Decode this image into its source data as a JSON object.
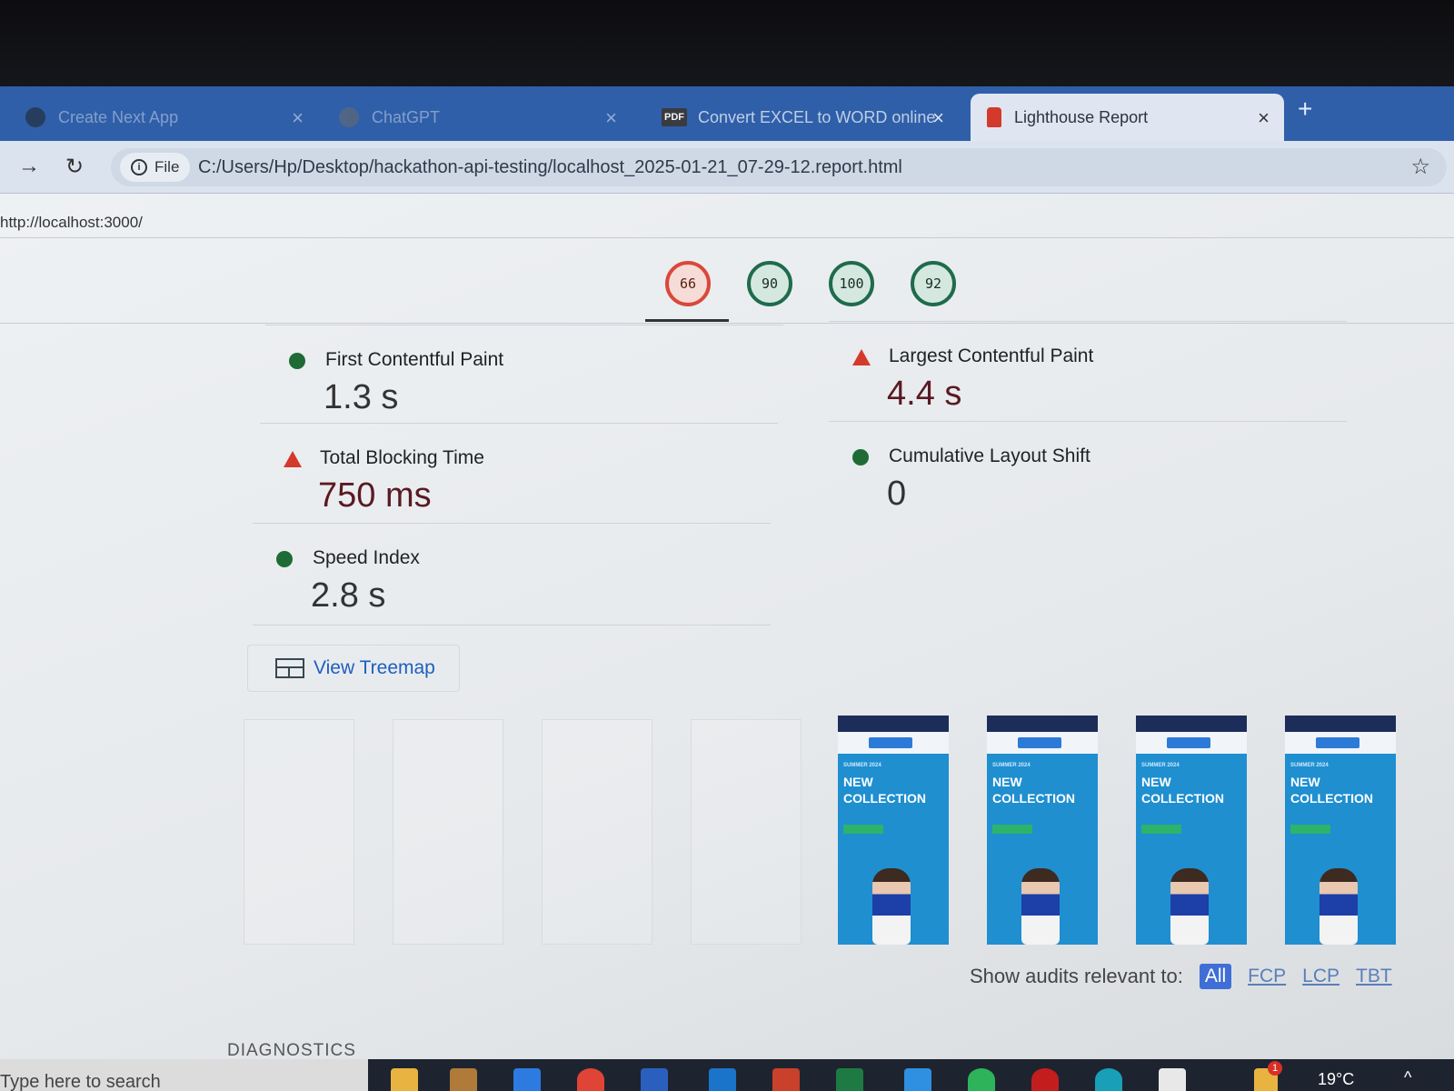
{
  "browser": {
    "tabs": [
      {
        "title": "Create Next App",
        "close": "×",
        "state": "inactive",
        "icon": "next-app-icon"
      },
      {
        "title": "ChatGPT",
        "close": "×",
        "state": "inactive",
        "icon": "chatgpt-icon"
      },
      {
        "title": "Convert EXCEL to WORD online",
        "close": "×",
        "state": "inactive",
        "icon": "pdf-icon",
        "badge": "PDF"
      },
      {
        "title": "Lighthouse Report",
        "close": "×",
        "state": "active",
        "icon": "lighthouse-icon"
      }
    ],
    "new_tab": "+",
    "toolbar": {
      "back": "→",
      "reload": "↻",
      "site_info": "File",
      "address": "C:/Users/Hp/Desktop/hackathon-api-testing/localhost_2025-01-21_07-29-12.report.html",
      "bookmark": "☆"
    }
  },
  "report": {
    "page_url": "http://localhost:3000/",
    "scores": [
      {
        "value": "66",
        "status": "poor",
        "color": "#d9483b"
      },
      {
        "value": "90",
        "status": "good",
        "color": "#1f6b4c"
      },
      {
        "value": "100",
        "status": "good",
        "color": "#1f6b4c"
      },
      {
        "value": "92",
        "status": "good",
        "color": "#1f6b4c"
      }
    ],
    "metrics": [
      {
        "label": "First Contentful Paint",
        "value": "1.3 s",
        "status": "pass"
      },
      {
        "label": "Largest Contentful Paint",
        "value": "4.4 s",
        "status": "fail"
      },
      {
        "label": "Total Blocking Time",
        "value": "750 ms",
        "status": "fail"
      },
      {
        "label": "Cumulative Layout Shift",
        "value": "0",
        "status": "pass"
      },
      {
        "label": "Speed Index",
        "value": "2.8 s",
        "status": "pass"
      }
    ],
    "treemap_button": "View Treemap",
    "filmstrip": {
      "frame_small_text": "SUMMER 2024",
      "frame_title_line1": "NEW",
      "frame_title_line2": "COLLECTION"
    },
    "audit_filter": {
      "label": "Show audits relevant to:",
      "options": [
        "All",
        "FCP",
        "LCP",
        "TBT"
      ],
      "selected": "All"
    },
    "diagnostics_heading": "DIAGNOSTICS"
  },
  "taskbar": {
    "search_placeholder": "Type here to search",
    "temperature": "19°C",
    "tray_chevron": "^",
    "notification_count": "1"
  }
}
